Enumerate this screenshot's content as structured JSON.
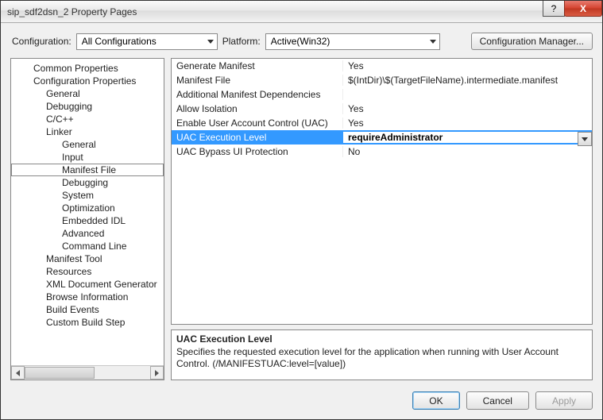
{
  "window": {
    "title": "sip_sdf2dsn_2 Property Pages"
  },
  "toolbar": {
    "config_label": "Configuration:",
    "config_value": "All Configurations",
    "platform_label": "Platform:",
    "platform_value": "Active(Win32)",
    "config_manager": "Configuration Manager..."
  },
  "tree": {
    "common": "Common Properties",
    "config": "Configuration Properties",
    "general": "General",
    "debugging": "Debugging",
    "ccpp": "C/C++",
    "linker": "Linker",
    "linker_general": "General",
    "linker_input": "Input",
    "linker_manifest": "Manifest File",
    "linker_debugging": "Debugging",
    "linker_system": "System",
    "linker_optimization": "Optimization",
    "linker_idl": "Embedded IDL",
    "linker_advanced": "Advanced",
    "linker_cmd": "Command Line",
    "manifest_tool": "Manifest Tool",
    "resources": "Resources",
    "xml_doc": "XML Document Generator",
    "browse_info": "Browse Information",
    "build_events": "Build Events",
    "custom_build": "Custom Build Step"
  },
  "grid": {
    "rows": [
      {
        "label": "Generate Manifest",
        "value": "Yes"
      },
      {
        "label": "Manifest File",
        "value": "$(IntDir)\\$(TargetFileName).intermediate.manifest"
      },
      {
        "label": "Additional Manifest Dependencies",
        "value": ""
      },
      {
        "label": "Allow Isolation",
        "value": "Yes"
      },
      {
        "label": "Enable User Account Control (UAC)",
        "value": "Yes"
      },
      {
        "label": "UAC Execution Level",
        "value": "requireAdministrator"
      },
      {
        "label": "UAC Bypass UI Protection",
        "value": "No"
      }
    ],
    "selected_index": 5
  },
  "description": {
    "title": "UAC Execution Level",
    "body": "Specifies the requested execution level for the application when running with User Account Control.  (/MANIFESTUAC:level=[value])"
  },
  "buttons": {
    "ok": "OK",
    "cancel": "Cancel",
    "apply": "Apply"
  },
  "winbtns": {
    "help": "?",
    "close": "X"
  }
}
